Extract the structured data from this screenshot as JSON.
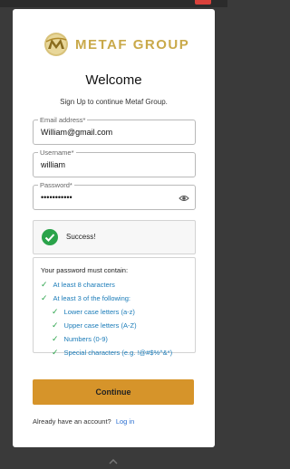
{
  "brand": {
    "name": "METAF GROUP",
    "gold": "#c9a94a",
    "icon": "metaf-logo-icon"
  },
  "header": {
    "title": "Welcome",
    "subtitle": "Sign Up to continue Metaf Group."
  },
  "form": {
    "email": {
      "label": "Email address*",
      "value": "William@gmail.com"
    },
    "username": {
      "label": "Username*",
      "value": "william"
    },
    "password": {
      "label": "Password*",
      "value": "•••••••••••",
      "toggle_icon": "eye-icon"
    }
  },
  "alert": {
    "text": "Success!",
    "icon": "check-circle-icon",
    "color": "#2aa34a"
  },
  "requirements": {
    "title": "Your password must contain:",
    "items": [
      "At least 8 characters",
      "At least 3 of the following:",
      "Lower case letters (a-z)",
      "Upper case letters (A-Z)",
      "Numbers (0-9)",
      "Special characters (e.g. !@#$%^&*)"
    ],
    "check_color": "#2aa34a",
    "text_color": "#1a7bb8"
  },
  "actions": {
    "continue_label": "Continue",
    "button_color": "#d6942a"
  },
  "footer": {
    "prompt": "Already have an account?",
    "login_label": "Log in"
  }
}
